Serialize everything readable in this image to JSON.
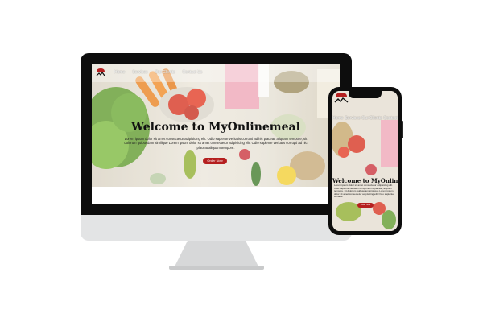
{
  "site": {
    "nav": [
      "Home",
      "Services",
      "Our Clients",
      "Contact Us"
    ],
    "hero_title": "Welcome to MyOnlinemeal",
    "hero_text": "Lorem ipsum dolor sit amet consectetur adipisicing elit. Odio sapiente veritatis corrupti ad hic placeat, aliquam tempore, sit dolorum quibusdam similique Lorem ipsum dolor sit amet consectetur adipisicing elit. Odio sapiente veritatis corrupti ad hic placeat aliquam tempore.",
    "order_button": "Order Now"
  },
  "phone": {
    "nav": [
      "Home",
      "Services",
      "Our Clients",
      "Contact"
    ],
    "hero_title": "Welcome to MyOnlinemeal",
    "hero_text": "Lorem ipsum dolor sit amet consectetur adipisicing elit. Odio sapiente veritatis corrupti ad hic placeat, aliquam tempore, sit dolorum quibusdam similique Lorem ipsum dolor sit amet consectetur adipisicing elit. Odio sapiente veritatis.",
    "order_button": "Order Now"
  },
  "colors": {
    "accent": "#b51f1f",
    "device": "#0d0d0d",
    "chin": "#e3e4e5",
    "stand": "#d7d8d9"
  },
  "icons": {
    "logo": "chef-hat-logo-icon"
  }
}
